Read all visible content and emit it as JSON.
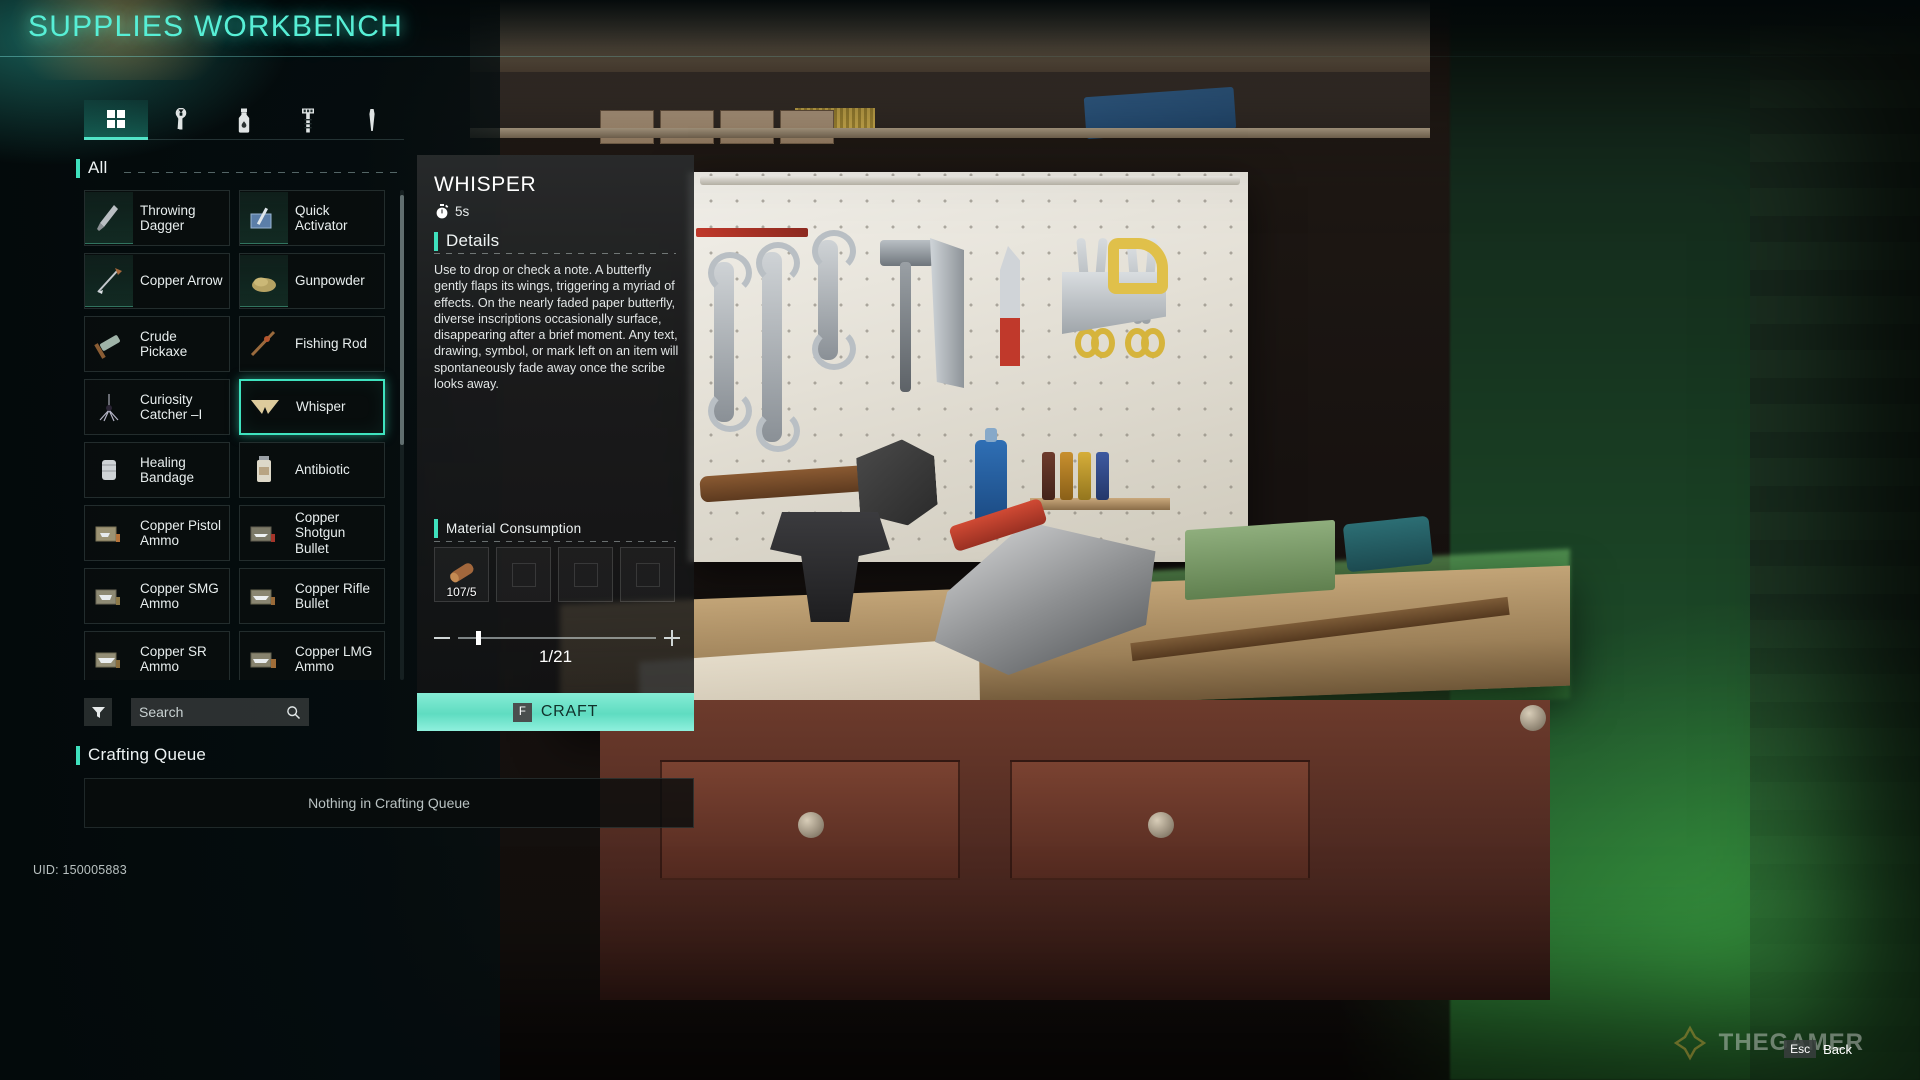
{
  "header": {
    "title": "SUPPLIES WORKBENCH"
  },
  "tabs": [
    {
      "id": "all",
      "icon": "grid-icon",
      "active": true
    },
    {
      "id": "tools",
      "icon": "wrench-icon",
      "active": false
    },
    {
      "id": "consumable",
      "icon": "bottle-icon",
      "active": false
    },
    {
      "id": "parts",
      "icon": "bolt-icon",
      "active": false
    },
    {
      "id": "misc",
      "icon": "nail-icon",
      "active": false
    }
  ],
  "list": {
    "section_label": "All",
    "items": [
      {
        "name": "Throwing Dagger",
        "icon": "dagger-icon",
        "selected": false,
        "lit": true
      },
      {
        "name": "Quick Activator",
        "icon": "activator-icon",
        "selected": false,
        "lit": true
      },
      {
        "name": "Copper Arrow",
        "icon": "arrow-icon",
        "selected": false,
        "lit": true
      },
      {
        "name": "Gunpowder",
        "icon": "gunpowder-icon",
        "selected": false,
        "lit": true
      },
      {
        "name": "Crude Pickaxe",
        "icon": "pickaxe-icon",
        "selected": false,
        "lit": false
      },
      {
        "name": "Fishing Rod",
        "icon": "fishing-rod-icon",
        "selected": false,
        "lit": false
      },
      {
        "name": "Curiosity Catcher –I",
        "icon": "catcher-icon",
        "selected": false,
        "lit": false
      },
      {
        "name": "Whisper",
        "icon": "whisper-icon",
        "selected": true,
        "lit": false
      },
      {
        "name": "Healing Bandage",
        "icon": "bandage-icon",
        "selected": false,
        "lit": false
      },
      {
        "name": "Antibiotic",
        "icon": "antibiotic-icon",
        "selected": false,
        "lit": false
      },
      {
        "name": "Copper Pistol Ammo",
        "icon": "pistol-ammo-icon",
        "selected": false,
        "lit": false
      },
      {
        "name": "Copper Shotgun Bullet",
        "icon": "shotgun-ammo-icon",
        "selected": false,
        "lit": false
      },
      {
        "name": "Copper SMG Ammo",
        "icon": "smg-ammo-icon",
        "selected": false,
        "lit": false
      },
      {
        "name": "Copper Rifle Bullet",
        "icon": "rifle-ammo-icon",
        "selected": false,
        "lit": false
      },
      {
        "name": "Copper SR Ammo",
        "icon": "sr-ammo-icon",
        "selected": false,
        "lit": false
      },
      {
        "name": "Copper LMG Ammo",
        "icon": "lmg-ammo-icon",
        "selected": false,
        "lit": false
      }
    ]
  },
  "search": {
    "placeholder": "Search",
    "value": "",
    "filter_icon": "filter-icon",
    "search_icon": "search-icon"
  },
  "queue": {
    "label": "Crafting Queue",
    "empty_text": "Nothing in Crafting Queue"
  },
  "footer": {
    "uid": "UID: 150005883",
    "esc_key": "Esc",
    "esc_label": "Back",
    "watermark": "THEGAMER"
  },
  "detail": {
    "title": "WHISPER",
    "craft_time": "5s",
    "timer_icon": "stopwatch-icon",
    "details_label": "Details",
    "description": "Use to drop or check a note. A butterfly gently flaps its wings, triggering a myriad of effects. On the nearly faded paper butterfly, diverse inscriptions occasionally surface, disappearing after a brief moment. Any text, drawing, symbol, or mark left on an item will spontaneously fade away once the scribe looks away.",
    "materials_label": "Material Consumption",
    "materials": [
      {
        "icon": "wood-log-icon",
        "count": "107/5",
        "empty": false
      },
      {
        "icon": "",
        "count": "",
        "empty": true
      },
      {
        "icon": "",
        "count": "",
        "empty": true
      },
      {
        "icon": "",
        "count": "",
        "empty": true
      }
    ],
    "quantity_text": "1/21",
    "quantity_current": 1,
    "quantity_max": 21,
    "craft_key": "F",
    "craft_label": "CRAFT"
  },
  "colors": {
    "accent_teal": "#3fe3bf",
    "title_teal": "#57efd6",
    "craft_button": "#6fe3c8",
    "panel_bg": "#2a2c2d"
  }
}
